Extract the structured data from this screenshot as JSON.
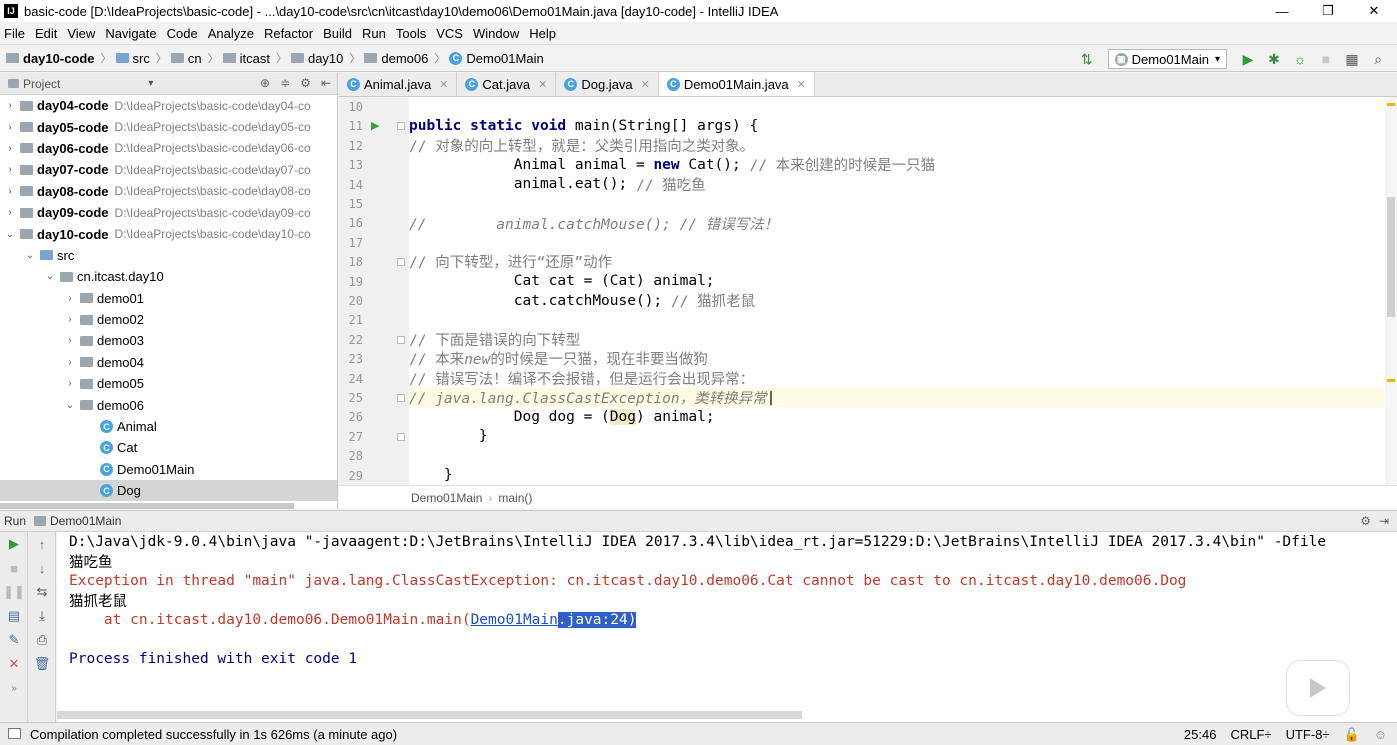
{
  "window": {
    "title": "basic-code [D:\\IdeaProjects\\basic-code] - ...\\day10-code\\src\\cn\\itcast\\day10\\demo06\\Demo01Main.java [day10-code] - IntelliJ IDEA",
    "app_icon": "IJ"
  },
  "menu": [
    "File",
    "Edit",
    "View",
    "Navigate",
    "Code",
    "Analyze",
    "Refactor",
    "Build",
    "Run",
    "Tools",
    "VCS",
    "Window",
    "Help"
  ],
  "breadcrumbs": [
    "day10-code",
    "src",
    "cn",
    "itcast",
    "day10",
    "demo06",
    "Demo01Main"
  ],
  "run_config": "Demo01Main",
  "project_panel": {
    "title": "Project",
    "tree": [
      {
        "label": "day04-code",
        "path": "D:\\IdeaProjects\\basic-code\\day04-co",
        "expanded": false,
        "indent": 0,
        "bold": true
      },
      {
        "label": "day05-code",
        "path": "D:\\IdeaProjects\\basic-code\\day05-co",
        "expanded": false,
        "indent": 0,
        "bold": true
      },
      {
        "label": "day06-code",
        "path": "D:\\IdeaProjects\\basic-code\\day06-co",
        "expanded": false,
        "indent": 0,
        "bold": true
      },
      {
        "label": "day07-code",
        "path": "D:\\IdeaProjects\\basic-code\\day07-co",
        "expanded": false,
        "indent": 0,
        "bold": true
      },
      {
        "label": "day08-code",
        "path": "D:\\IdeaProjects\\basic-code\\day08-co",
        "expanded": false,
        "indent": 0,
        "bold": true
      },
      {
        "label": "day09-code",
        "path": "D:\\IdeaProjects\\basic-code\\day09-co",
        "expanded": false,
        "indent": 0,
        "bold": true
      },
      {
        "label": "day10-code",
        "path": "D:\\IdeaProjects\\basic-code\\day10-co",
        "expanded": true,
        "indent": 0,
        "bold": true
      },
      {
        "label": "src",
        "path": "",
        "expanded": true,
        "indent": 1,
        "bold": false
      },
      {
        "label": "cn.itcast.day10",
        "path": "",
        "expanded": true,
        "indent": 2,
        "bold": false
      },
      {
        "label": "demo01",
        "path": "",
        "expanded": false,
        "indent": 3,
        "bold": false
      },
      {
        "label": "demo02",
        "path": "",
        "expanded": false,
        "indent": 3,
        "bold": false
      },
      {
        "label": "demo03",
        "path": "",
        "expanded": false,
        "indent": 3,
        "bold": false
      },
      {
        "label": "demo04",
        "path": "",
        "expanded": false,
        "indent": 3,
        "bold": false
      },
      {
        "label": "demo05",
        "path": "",
        "expanded": false,
        "indent": 3,
        "bold": false
      },
      {
        "label": "demo06",
        "path": "",
        "expanded": true,
        "indent": 3,
        "bold": false
      },
      {
        "label": "Animal",
        "path": "",
        "class": true,
        "indent": 4,
        "bold": false
      },
      {
        "label": "Cat",
        "path": "",
        "class": true,
        "indent": 4,
        "bold": false
      },
      {
        "label": "Demo01Main",
        "path": "",
        "class": true,
        "indent": 4,
        "bold": false
      },
      {
        "label": "Dog",
        "path": "",
        "class": true,
        "indent": 4,
        "bold": false,
        "selected": true
      }
    ]
  },
  "editor": {
    "tabs": [
      {
        "label": "Animal.java",
        "active": false
      },
      {
        "label": "Cat.java",
        "active": false
      },
      {
        "label": "Dog.java",
        "active": false
      },
      {
        "label": "Demo01Main.java",
        "active": true
      }
    ],
    "footer_crumbs": [
      "Demo01Main",
      "main()"
    ],
    "lines": [
      {
        "n": "10",
        "html": ""
      },
      {
        "n": "11",
        "html": "        <span class=\"kw\">public static void</span> main(String[] args) {",
        "run": true,
        "fold": true
      },
      {
        "n": "12",
        "html": "            <span class=\"cm\">// 对象的向上转型，就是：父类引用指向之类对象。</span>"
      },
      {
        "n": "13",
        "html": "            Animal animal = <span class=\"kw\">new</span> Cat(); <span class=\"cm\">// 本来创建的时候是一只猫</span>"
      },
      {
        "n": "14",
        "html": "            animal.eat(); <span class=\"cm\">// 猫吃鱼</span>"
      },
      {
        "n": "15",
        "html": ""
      },
      {
        "n": "16",
        "html": "<span class=\"cmi\">//        animal.catchMouse(); // 错误写法！</span>"
      },
      {
        "n": "17",
        "html": ""
      },
      {
        "n": "18",
        "html": "            <span class=\"cm\">// 向下转型，进行“还原”动作</span>",
        "fold": true
      },
      {
        "n": "19",
        "html": "            Cat cat = (Cat) animal;"
      },
      {
        "n": "20",
        "html": "            cat.catchMouse(); <span class=\"cm\">// 猫抓老鼠</span>"
      },
      {
        "n": "21",
        "html": ""
      },
      {
        "n": "22",
        "html": "            <span class=\"cm\">// 下面是错误的向下转型</span>",
        "fold": true
      },
      {
        "n": "23",
        "html": "            <span class=\"cm\">// 本来<i>new</i>的时候是一只猫，现在非要当做狗</span>"
      },
      {
        "n": "24",
        "html": "            <span class=\"cm\">// 错误写法！编译不会报错，但是运行会出现异常：</span>"
      },
      {
        "n": "25",
        "html": "            <span class=\"cmi\">// java.lang.ClassCastException，类转换异常</span>|",
        "current": true,
        "fold": true
      },
      {
        "n": "26",
        "html": "            Dog dog = (<span class=\"hl\">Dog</span>) animal;"
      },
      {
        "n": "27",
        "html": "        }",
        "fold": true
      },
      {
        "n": "28",
        "html": ""
      },
      {
        "n": "29",
        "html": "    }"
      }
    ]
  },
  "run_panel": {
    "label": "Run",
    "tab": "Demo01Main",
    "console": {
      "cmd": "D:\\Java\\jdk-9.0.4\\bin\\java \"-javaagent:D:\\JetBrains\\IntelliJ IDEA 2017.3.4\\lib\\idea_rt.jar=51229:D:\\JetBrains\\IntelliJ IDEA 2017.3.4\\bin\" -Dfile",
      "out1": "猫吃鱼",
      "exception": "Exception in thread \"main\" java.lang.ClassCastException: cn.itcast.day10.demo06.Cat cannot be cast to cn.itcast.day10.demo06.Dog",
      "out2": "猫抓老鼠",
      "stack_prefix": "    at cn.itcast.day10.demo06.Demo01Main.main(",
      "stack_link": "Demo01Main",
      "stack_sel": ".java:24)",
      "blank": "",
      "finished": "Process finished with exit code 1"
    }
  },
  "status_bar": {
    "message": "Compilation completed successfully in 1s 626ms (a minute ago)",
    "position": "25:46",
    "line_sep": "CRLF÷",
    "encoding": "UTF-8÷"
  }
}
